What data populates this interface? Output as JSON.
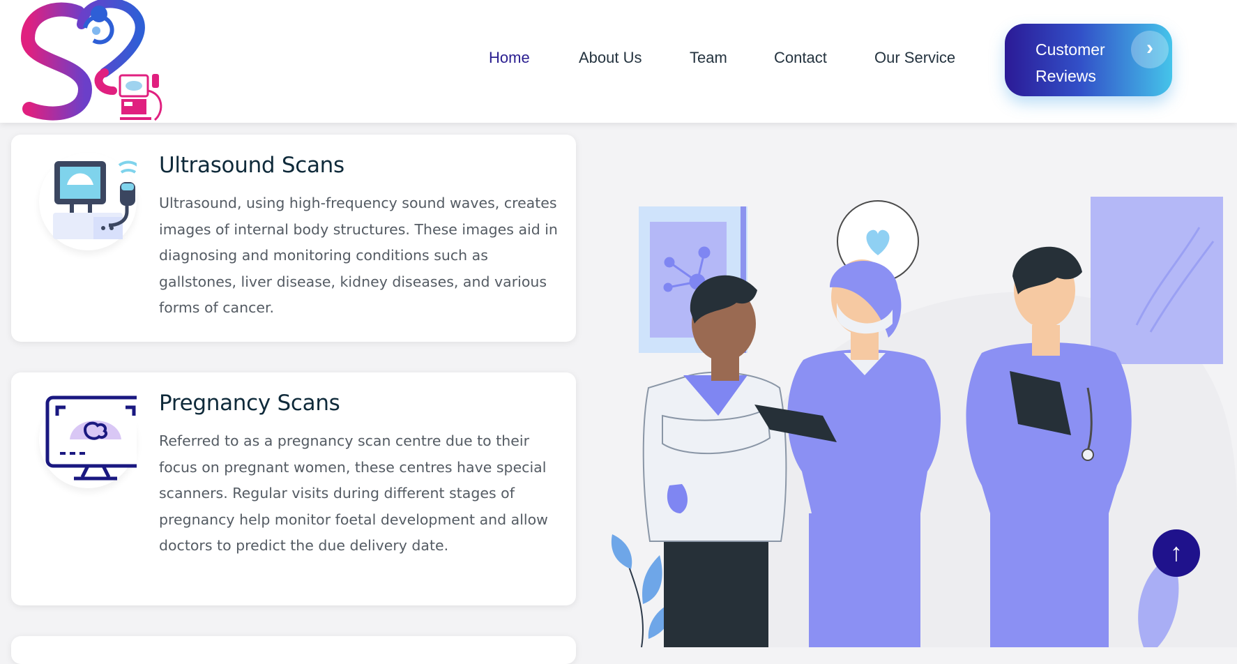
{
  "nav": {
    "items": [
      {
        "label": "Home",
        "active": true
      },
      {
        "label": "About Us",
        "active": false
      },
      {
        "label": "Team",
        "active": false
      },
      {
        "label": "Contact",
        "active": false
      },
      {
        "label": "Our Service",
        "active": false
      }
    ],
    "cta_label": "Customer Reviews"
  },
  "services": [
    {
      "title": "Ultrasound Scans",
      "description": "Ultrasound, using high-frequency sound waves, creates images of internal body structures. These images aid in diagnosing and monitoring conditions such as gallstones, liver disease, kidney diseases, and various forms of cancer.",
      "icon": "ultrasound-machine-icon"
    },
    {
      "title": "Pregnancy Scans",
      "description": "Referred to as a pregnancy scan centre due to their focus on pregnant women, these centres have special scanners. Regular visits during different stages of pregnancy help monitor foetal development and allow doctors to predict the due delivery date.",
      "icon": "pregnancy-monitor-icon"
    }
  ],
  "colors": {
    "brand_pink": "#e0207f",
    "brand_blue": "#2e5fd6",
    "nav_active": "#2a1e90",
    "cta_start": "#2b1a96",
    "cta_end": "#45c4ea",
    "accent_purple": "#7f86f2"
  }
}
